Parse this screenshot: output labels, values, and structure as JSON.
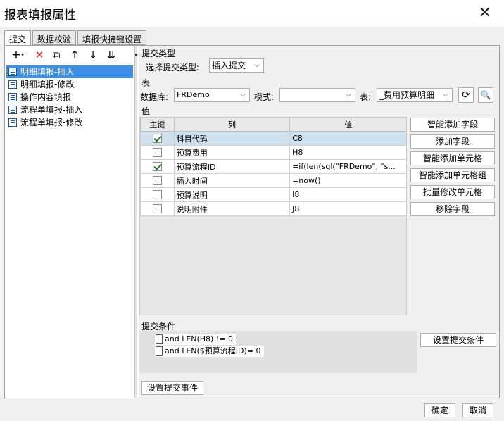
{
  "window": {
    "title": "报表填报属性"
  },
  "tabs": [
    "提交",
    "数据校验",
    "填报快捷键设置"
  ],
  "tree": [
    "明细填报-插入",
    "明细填报-修改",
    "操作内容填报",
    "流程单填报-插入",
    "流程单填报-修改"
  ],
  "submit_type": {
    "section": "提交类型",
    "label": "选择提交类型:",
    "value": "插入提交"
  },
  "table_section": {
    "section": "表",
    "db_label": "数据库:",
    "db_value": "FRDemo",
    "schema_label": "模式:",
    "schema_value": "",
    "table_label": "表:",
    "table_value": "_费用预算明细"
  },
  "values": {
    "section": "值",
    "headers": [
      "主键",
      "列",
      "值"
    ],
    "rows": [
      {
        "key": true,
        "column": "科目代码",
        "value": "C8"
      },
      {
        "key": false,
        "column": "预算费用",
        "value": "H8"
      },
      {
        "key": true,
        "column": "预算流程ID",
        "value": "=if(len(sql(\"FRDemo\", \"s..."
      },
      {
        "key": false,
        "column": "插入时间",
        "value": "=now()"
      },
      {
        "key": false,
        "column": "预算说明",
        "value": "I8"
      },
      {
        "key": false,
        "column": "说明附件",
        "value": "J8"
      }
    ]
  },
  "right_buttons": [
    "智能添加字段",
    "添加字段",
    "智能添加单元格",
    "智能添加单元格组",
    "批量修改单元格",
    "移除字段"
  ],
  "conditions": {
    "section": "提交条件",
    "items": [
      "and LEN(H8) != 0",
      "and LEN($预算流程ID)= 0"
    ],
    "button": "设置提交条件"
  },
  "event_button": "设置提交事件",
  "footer": {
    "ok": "确定",
    "cancel": "取消"
  }
}
